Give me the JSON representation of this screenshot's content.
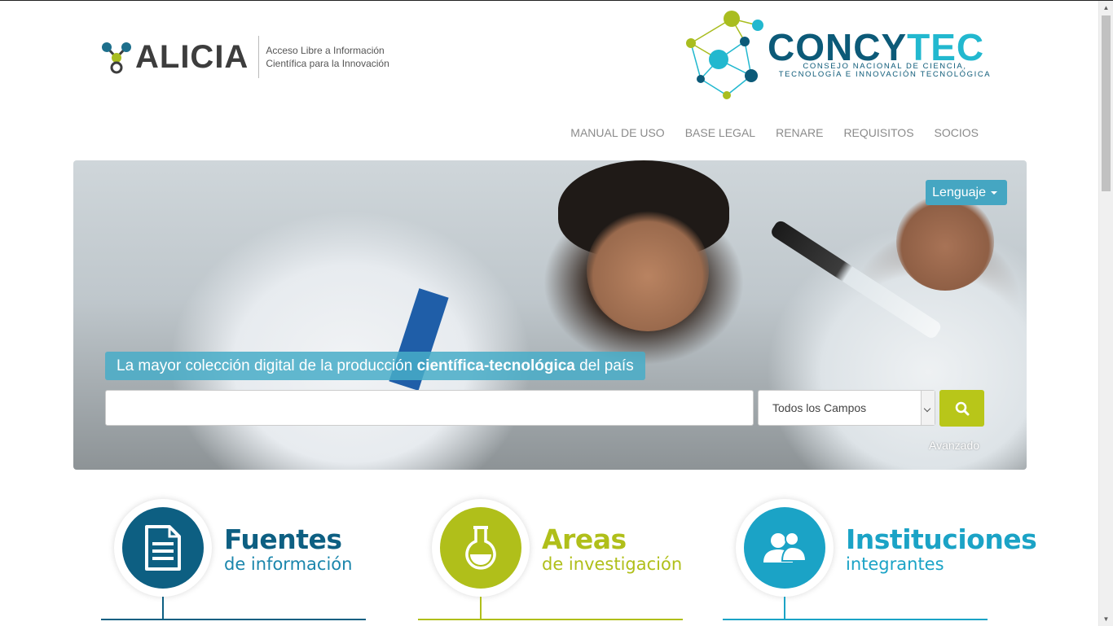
{
  "header": {
    "alicia_name": "ALICIA",
    "alicia_tagline_1": "Acceso Libre a Información",
    "alicia_tagline_2": "Científica para la Innovación",
    "concytec_name_main": "CONCY",
    "concytec_name_accent": "TEC",
    "concytec_sub_1": "CONSEJO NACIONAL DE CIENCIA,",
    "concytec_sub_2": "TECNOLOGÍA E INNOVACIÓN TECNOLÓGICA"
  },
  "nav": {
    "items": [
      "MANUAL DE USO",
      "BASE LEGAL",
      "RENARE",
      "REQUISITOS",
      "SOCIOS"
    ]
  },
  "hero": {
    "language_button": "Lenguaje",
    "tagline_prefix": "La mayor colección digital de la producción ",
    "tagline_bold": "científica-tecnológica",
    "tagline_suffix": " del país",
    "search_value": "",
    "search_field_selected": "Todos los Campos",
    "advanced_link": "Avanzado"
  },
  "features": [
    {
      "title": "Fuentes",
      "subtitle": "de información",
      "icon": "document-icon",
      "color": "#0d5f82"
    },
    {
      "title": "Areas",
      "subtitle": "de investigación",
      "icon": "flask-icon",
      "color": "#b0bf1a"
    },
    {
      "title": "Instituciones",
      "subtitle": "integrantes",
      "icon": "users-icon",
      "color": "#1ba3c6"
    }
  ],
  "colors": {
    "accent_blue": "#45a6c2",
    "search_green": "#b8c619",
    "dark_blue": "#0c5a78"
  }
}
